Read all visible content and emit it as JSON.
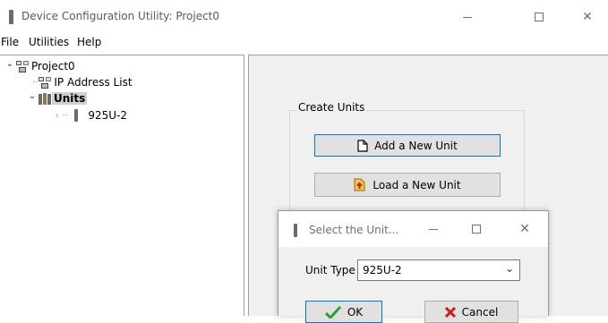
{
  "window": {
    "title": "Device Configuration Utility: Project0",
    "controls": {
      "minimize": "minimize-icon",
      "maximize": "maximize-icon",
      "close": "close-icon",
      "close_glyph": "✕"
    }
  },
  "menu": {
    "items": [
      {
        "label": "File"
      },
      {
        "label": "Utilities"
      },
      {
        "label": "Help"
      }
    ]
  },
  "tree": {
    "root": {
      "label": "Project0",
      "icon": "network-icon",
      "expanded": true
    },
    "items": [
      {
        "label": "IP Address List",
        "icon": "network-icon"
      },
      {
        "label": "Units",
        "icon": "units-icon",
        "expanded": true,
        "selected": true
      },
      {
        "label": "925U-2",
        "icon": "device-icon",
        "expanded": false
      }
    ],
    "expanded_glyph": "⌄",
    "collapsed_glyph": "›",
    "connector": "··"
  },
  "group": {
    "title": "Create Units",
    "add_label": "Add a New Unit",
    "add_icon": "new-document-icon",
    "load_label": "Load a New Unit",
    "load_icon": "load-document-icon"
  },
  "dialog": {
    "title": "Select the Unit...",
    "close_glyph": "✕",
    "unit_type_label": "Unit Type",
    "unit_type_value": "925U-2",
    "dropdown_glyph": "⌄",
    "ok_label": "OK",
    "cancel_label": "Cancel",
    "ok_icon": "checkmark-icon",
    "cancel_icon": "x-mark-icon"
  },
  "colors": {
    "focus_border": "#0078d7",
    "content_bg": "#f0f0f0",
    "check_green": "#2e9e2e",
    "cancel_red": "#c8211b",
    "selection_bg": "#cfcfcf"
  }
}
